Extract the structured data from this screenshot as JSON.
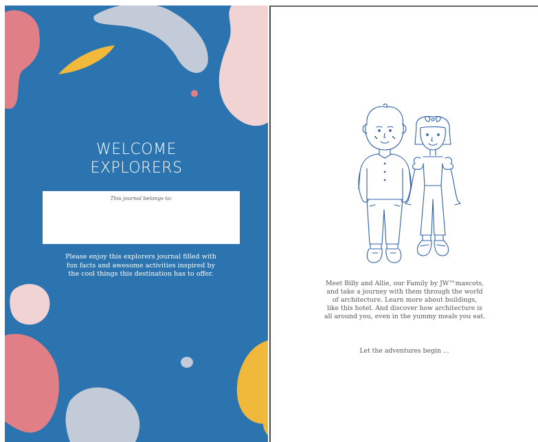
{
  "left_page": {
    "title_lines": [
      "WELCOME",
      "EXPLORERS"
    ],
    "belongs_label": "This journal belongs to:",
    "intro_lines": [
      "Please enjoy this explorers journal filled with",
      "fun facts and awesome activities inspired by",
      "the cool things this destination has to offer."
    ],
    "colors": {
      "background": "#2c74b0",
      "pink": "#e07f86",
      "light_pink": "#f1d3d3",
      "yellow": "#f0b93b",
      "grey": "#c4cbd8"
    }
  },
  "right_page": {
    "illustration": "billy-and-allie-mascots-illustration",
    "meet_lines": [
      "Meet Billy and Allie, our Family by JW™mascots,",
      "and take a journey with them through the world",
      "of architecture. Learn more about buildings,",
      "like this hotel. And discover how architecture is",
      "all around you, even in the yummy meals you eat."
    ],
    "adventures_line": "Let the adventures begin ...",
    "colors": {
      "line_art": "#2c5fa8"
    }
  }
}
